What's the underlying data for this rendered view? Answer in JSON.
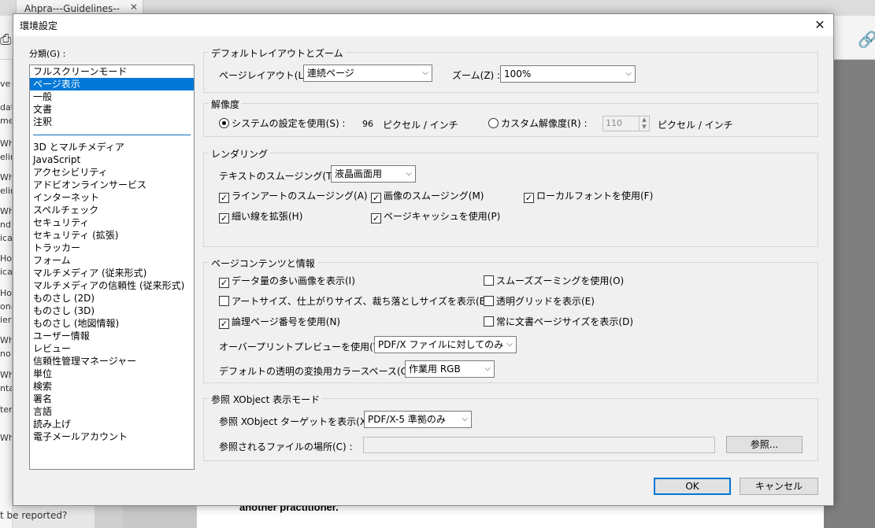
{
  "background": {
    "tab_title": "Ahpra---Guidelines--",
    "tab_close": "✕",
    "sidebar_fragments": [
      "ve",
      "dat",
      "me",
      "Wh",
      "elin",
      "Wh",
      "elin",
      "Wh",
      "nd",
      "ica",
      "How",
      "ica",
      "How",
      "ona",
      "ier",
      "Wh",
      "no",
      "Wh",
      "nta",
      "tern",
      "Wh"
    ],
    "question_text": "t be reported?",
    "document_lines": [
      "another practitioner."
    ]
  },
  "dialog": {
    "title": "環境設定",
    "close_icon": "✕",
    "categories_label": "分類(G) :",
    "categories_top": [
      "フルスクリーンモード",
      "ページ表示",
      "一般",
      "文書",
      "注釈"
    ],
    "categories_bottom": [
      "3D とマルチメディア",
      "JavaScript",
      "アクセシビリティ",
      "アドビオンラインサービス",
      "インターネット",
      "スペルチェック",
      "セキュリティ",
      "セキュリティ (拡張)",
      "トラッカー",
      "フォーム",
      "マルチメディア (従来形式)",
      "マルチメディアの信頼性 (従来形式)",
      "ものさし (2D)",
      "ものさし (3D)",
      "ものさし (地図情報)",
      "ユーザー情報",
      "レビュー",
      "信頼性管理マネージャー",
      "単位",
      "検索",
      "署名",
      "言語",
      "読み上げ",
      "電子メールアカウント"
    ],
    "layout": {
      "title": "デフォルトレイアウトとズーム",
      "page_layout_label": "ページレイアウト(L) :",
      "page_layout_value": "連続ページ",
      "zoom_label": "ズーム(Z) :",
      "zoom_value": "100%"
    },
    "resolution": {
      "title": "解像度",
      "system_label": "システムの設定を使用(S) :",
      "system_value": "96",
      "system_unit": "ピクセル / インチ",
      "custom_label": "カスタム解像度(R) :",
      "custom_value": "110",
      "custom_unit": "ピクセル / インチ"
    },
    "rendering": {
      "title": "レンダリング",
      "text_smoothing_label": "テキストのスムージング(T) :",
      "text_smoothing_value": "液晶画面用",
      "smooth_line_art": "ラインアートのスムージング(A)",
      "smooth_images": "画像のスムージング(M)",
      "use_local_fonts": "ローカルフォントを使用(F)",
      "enhance_thin_lines": "細い線を拡張(H)",
      "use_page_cache": "ページキャッシュを使用(P)"
    },
    "page_content": {
      "title": "ページコンテンツと情報",
      "show_large_images": "データ量の多い画像を表示(I)",
      "smooth_zoom": "スムーズズーミングを使用(O)",
      "show_art_trim_bleed": "アートサイズ、仕上がりサイズ、裁ち落としサイズを表示(B)",
      "show_transparency_grid": "透明グリッドを表示(E)",
      "use_logical_page_numbers": "論理ページ番号を使用(N)",
      "always_show_doc_page_size": "常に文書ページサイズを表示(D)",
      "overprint_label": "オーバープリントプレビューを使用(W) :",
      "overprint_value": "PDF/X ファイルに対してのみ",
      "blend_label": "デフォルトの透明の変換用カラースペース(C) :",
      "blend_value": "作業用 RGB"
    },
    "xobject": {
      "title": "参照 XObject 表示モード",
      "target_label": "参照 XObject ターゲットを表示(X) :",
      "target_value": "PDF/X-5 準拠のみ",
      "location_label": "参照されるファイルの場所(C) :",
      "location_value": "",
      "browse_label": "参照..."
    },
    "ok_label": "OK",
    "cancel_label": "キャンセル"
  }
}
